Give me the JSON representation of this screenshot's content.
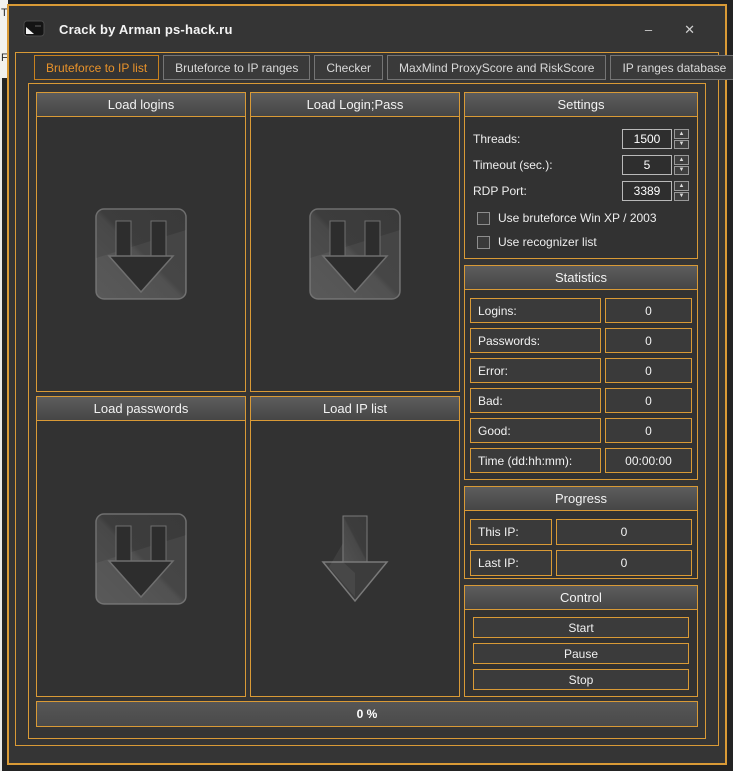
{
  "background": {
    "letters": [
      "T",
      "F"
    ]
  },
  "window": {
    "title": "Crack by Arman ps-hack.ru",
    "minimize": "–",
    "close": "✕"
  },
  "tabs": [
    {
      "label": "Bruteforce to IP list",
      "active": true
    },
    {
      "label": "Bruteforce to IP ranges",
      "active": false
    },
    {
      "label": "Checker",
      "active": false
    },
    {
      "label": "MaxMind ProxyScore and RiskScore",
      "active": false
    },
    {
      "label": "IP ranges database",
      "active": false
    }
  ],
  "load_panels": [
    {
      "title": "Load logins",
      "icon": "download-square-icon"
    },
    {
      "title": "Load Login;Pass",
      "icon": "download-square-icon"
    },
    {
      "title": "Load passwords",
      "icon": "download-square-icon"
    },
    {
      "title": "Load IP list",
      "icon": "download-arrow-icon"
    }
  ],
  "settings": {
    "title": "Settings",
    "fields": [
      {
        "label": "Threads:",
        "value": "1500"
      },
      {
        "label": "Timeout (sec.):",
        "value": "5"
      },
      {
        "label": "RDP Port:",
        "value": "3389"
      }
    ],
    "checkboxes": [
      {
        "label": "Use bruteforce Win XP / 2003",
        "checked": false
      },
      {
        "label": "Use recognizer list",
        "checked": false
      }
    ]
  },
  "statistics": {
    "title": "Statistics",
    "rows": [
      {
        "label": "Logins:",
        "value": "0"
      },
      {
        "label": "Passwords:",
        "value": "0"
      },
      {
        "label": "Error:",
        "value": "0"
      },
      {
        "label": "Bad:",
        "value": "0"
      },
      {
        "label": "Good:",
        "value": "0"
      },
      {
        "label": "Time (dd:hh:mm):",
        "value": "00:00:00"
      }
    ]
  },
  "progress": {
    "title": "Progress",
    "rows": [
      {
        "label": "This IP:",
        "value": "0"
      },
      {
        "label": "Last IP:",
        "value": "0"
      }
    ]
  },
  "control": {
    "title": "Control",
    "buttons": [
      "Start",
      "Pause",
      "Stop"
    ]
  },
  "progress_bar": {
    "value": "0 %"
  },
  "colors": {
    "accent_border": "#d99a36",
    "active_tab_text": "#e8922a",
    "window_bg": "#353535",
    "header_gradient_top": "#5d5d5d",
    "header_gradient_bottom": "#464646"
  }
}
